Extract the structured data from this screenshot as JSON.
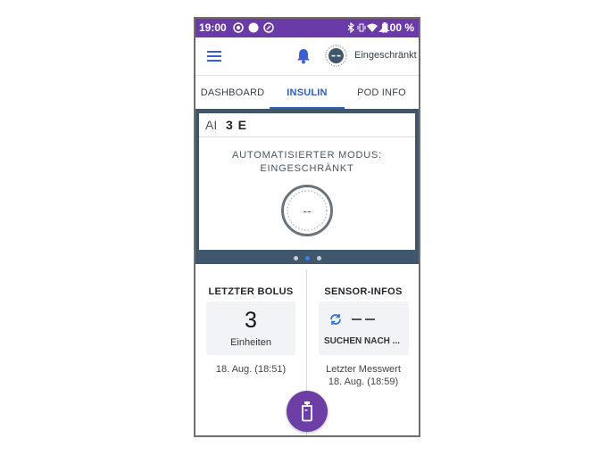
{
  "status_bar": {
    "time": "19:00",
    "battery_percent": "100 %",
    "icons": [
      "record-icon",
      "circle-icon",
      "at-icon",
      "bluetooth-icon",
      "vibrate-icon",
      "wifi-icon",
      "signal-icon",
      "battery-icon"
    ]
  },
  "app_bar": {
    "mode_label": "Eingeschränkt",
    "icons": [
      "menu-icon",
      "bell-icon",
      "mode-status-icon"
    ]
  },
  "tabs": [
    {
      "label": "DASHBOARD",
      "active": false
    },
    {
      "label": "INSULIN",
      "active": true
    },
    {
      "label": "POD INFO",
      "active": false
    }
  ],
  "insulin_card": {
    "iob_label": "AI",
    "iob_value": "3 E",
    "mode_title_line1": "AUTOMATISIERTER MODUS:",
    "mode_title_line2": "EINGESCHRÄNKT",
    "gauge_value": "--"
  },
  "pager": {
    "count": 3,
    "active_index": 1
  },
  "last_bolus": {
    "title": "LETZTER BOLUS",
    "value": "3",
    "unit": "Einheiten",
    "timestamp": "18. Aug. (18:51)"
  },
  "sensor_info": {
    "title": "SENSOR-INFOS",
    "value": "– –",
    "status": "SUCHEN NACH ...",
    "last_reading_label": "Letzter Messwert",
    "last_reading_time": "18. Aug. (18:59)"
  },
  "fab": {
    "icon": "bolus-vial-icon"
  },
  "colors": {
    "status_bar": "#6a3aa8",
    "accent_blue": "#2f5fc4",
    "panel_slate": "#3f566b",
    "fab_purple": "#6d3fa6"
  }
}
